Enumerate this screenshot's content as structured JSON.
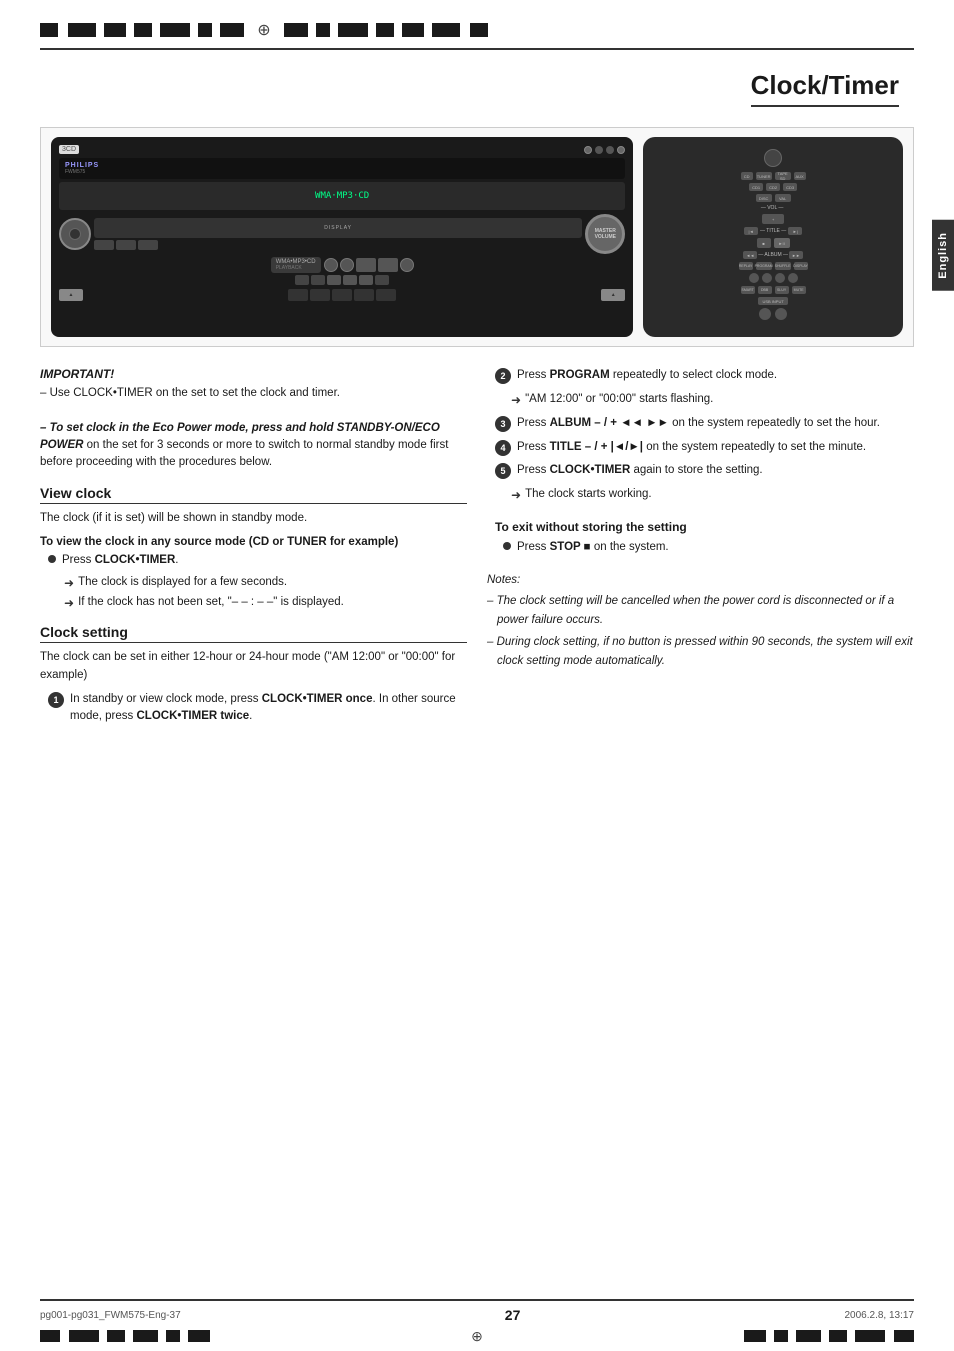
{
  "page": {
    "title": "Clock/Timer",
    "page_number": "27",
    "language_tab": "English",
    "bottom_left": "pg001-pg031_FWM575-Eng-37",
    "bottom_center": "27",
    "bottom_right": "2006.2.8, 13:17"
  },
  "device": {
    "brand": "PHILIPS",
    "model": "FWM575",
    "subtitle": "WMA•MP3•CD",
    "subtitle2": "PLAYBACK",
    "display": "WMA·MP3·CD"
  },
  "important": {
    "label": "IMPORTANT!",
    "line1": "– Use CLOCK•TIMER on the set to set the clock and timer.",
    "line2_italic": "– To set clock in the Eco Power mode, press and hold STANDBY-ON/ECO POWER",
    "line2_cont": " on the set for 3 seconds or more to switch to normal standby mode first before proceeding with the procedures below."
  },
  "view_clock": {
    "title": "View clock",
    "body": "The clock (if it is set) will be shown in standby mode.",
    "subsection": "To view the clock in any source mode (CD or TUNER for example)",
    "step1": "Press CLOCK•TIMER.",
    "arrow1": "The clock is displayed for a few seconds.",
    "arrow2": "If the clock has not been set, \"– – : – –\" is displayed."
  },
  "clock_setting": {
    "title": "Clock setting",
    "body": "The clock can be set in either 12-hour or 24-hour mode (\"AM  12:00\" or \"00:00\" for example)",
    "step1_text": "In standby or view clock mode, press CLOCK•TIMER once.  In other source mode, press CLOCK•TIMER twice."
  },
  "right_column": {
    "step2_label": "2",
    "step2_text": "Press PROGRAM repeatedly to select clock mode.",
    "step2_arrow": "\"AM  12:00\" or \"00:00\" starts flashing.",
    "step3_label": "3",
    "step3_text": "Press ALBUM – / +  ◄◄►► on the system repeatedly to set the hour.",
    "step4_label": "4",
    "step4_text": "Press TITLE – / + |◄/►| on the system repeatedly to set the minute.",
    "step5_label": "5",
    "step5_text": "Press CLOCK•TIMER again to store the setting.",
    "step5_arrow": "The clock starts working.",
    "exit_title": "To exit without storing the setting",
    "exit_bullet": "Press STOP ■  on the system.",
    "notes_label": "Notes:",
    "note1": "– The clock setting will be cancelled when the power cord is disconnected or if a power failure occurs.",
    "note2": "– During clock setting, if no button is pressed within 90 seconds, the system will exit clock setting mode automatically."
  }
}
